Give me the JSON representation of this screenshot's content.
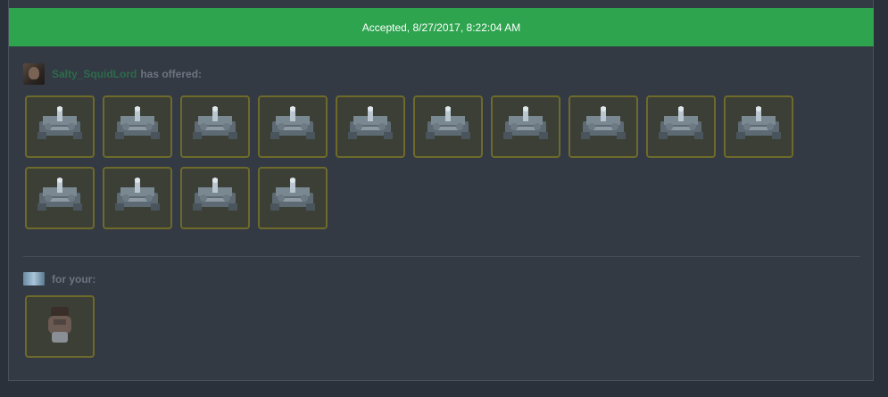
{
  "status": {
    "text": "Accepted, 8/27/2017, 8:22:04 AM",
    "color": "#2ea44f"
  },
  "offer": {
    "username": "Salty_SquidLord",
    "offered_label": "has offered:",
    "item_count": 14,
    "item_icon": "metal-machine-icon"
  },
  "request": {
    "for_label": "for your:",
    "item_count": 1,
    "item_icon": "glove-icon"
  },
  "colors": {
    "item_border": "#6e6a2a",
    "username": "#2d6b4a",
    "background": "#333a44"
  }
}
